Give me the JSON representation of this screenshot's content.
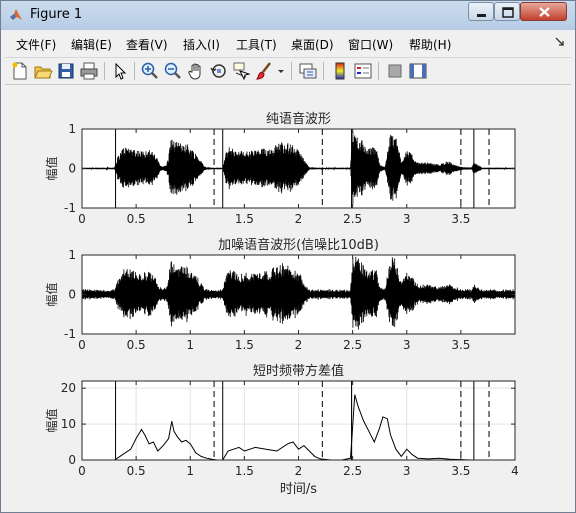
{
  "window": {
    "title": "Figure 1",
    "minimize_icon": "minimize-icon",
    "maximize_icon": "maximize-icon",
    "close_icon": "close-icon",
    "app_icon": "matlab-logo-icon"
  },
  "menubar": {
    "items": [
      "文件(F)",
      "编辑(E)",
      "查看(V)",
      "插入(I)",
      "工具(T)",
      "桌面(D)",
      "窗口(W)",
      "帮助(H)"
    ],
    "dock_icon": "dock-arrow-icon"
  },
  "toolbar": {
    "buttons": [
      "new-figure-icon",
      "open-file-icon",
      "save-icon",
      "print-icon",
      "select-pointer-icon",
      "zoom-in-icon",
      "zoom-out-icon",
      "pan-hand-icon",
      "rotate-3d-icon",
      "data-cursor-icon",
      "brush-icon",
      "brush-dropdown-icon",
      "link-plot-icon",
      "colorbar-icon",
      "legend-icon",
      "hide-plot-tools-icon",
      "show-plot-tools-icon"
    ]
  },
  "chart_data": [
    {
      "type": "line",
      "title": "纯语音波形",
      "xlabel": "",
      "ylabel": "幅值",
      "xlim": [
        0,
        4
      ],
      "ylim": [
        -1,
        1
      ],
      "xticks": [
        0,
        0.5,
        1,
        1.5,
        2,
        2.5,
        3,
        3.5
      ],
      "yticks": [
        -1,
        0,
        1
      ],
      "series": [
        {
          "style": "waveform",
          "color": "#000000",
          "envelope": {
            "t": [
              0.0,
              0.3,
              0.33,
              0.38,
              0.45,
              0.55,
              0.62,
              0.68,
              0.72,
              0.75,
              0.78,
              0.8,
              0.82,
              0.85,
              0.9,
              0.95,
              1.0,
              1.05,
              1.1,
              1.13,
              1.2,
              1.3,
              1.33,
              1.36,
              1.45,
              1.55,
              1.65,
              1.75,
              1.85,
              1.95,
              2.02,
              2.07,
              2.1,
              2.2,
              2.35,
              2.48,
              2.5,
              2.55,
              2.65,
              2.72,
              2.75,
              2.8,
              2.85,
              2.9,
              2.95,
              3.0,
              3.05,
              3.1,
              3.2,
              3.3,
              3.38,
              3.45,
              3.5,
              3.6,
              3.62,
              3.7,
              3.8,
              4.0
            ],
            "a": [
              0.02,
              0.02,
              0.3,
              0.55,
              0.55,
              0.45,
              0.5,
              0.35,
              0.1,
              0.05,
              0.1,
              0.3,
              0.8,
              0.7,
              0.65,
              0.7,
              0.55,
              0.4,
              0.2,
              0.05,
              0.02,
              0.02,
              0.4,
              0.55,
              0.45,
              0.45,
              0.5,
              0.55,
              0.7,
              0.6,
              0.4,
              0.15,
              0.03,
              0.02,
              0.02,
              0.02,
              0.95,
              0.85,
              0.5,
              0.6,
              0.1,
              0.05,
              0.9,
              0.85,
              0.2,
              0.5,
              0.35,
              0.15,
              0.15,
              0.1,
              0.2,
              0.08,
              0.04,
              0.03,
              0.15,
              0.02,
              0.02,
              0.02
            ]
          }
        }
      ],
      "vlines_solid": [
        0.31,
        1.3,
        2.49,
        3.62
      ],
      "vlines_dashed": [
        1.22,
        2.22,
        3.5,
        3.76
      ]
    },
    {
      "type": "line",
      "title": "加噪语音波形(信噪比10dB)",
      "xlabel": "",
      "ylabel": "幅值",
      "xlim": [
        0,
        4
      ],
      "ylim": [
        -1,
        1
      ],
      "xticks": [
        0,
        0.5,
        1,
        1.5,
        2,
        2.5,
        3,
        3.5
      ],
      "yticks": [
        -1,
        0,
        1
      ],
      "series": [
        {
          "style": "waveform",
          "color": "#000000",
          "noise_level": 0.12
        }
      ]
    },
    {
      "type": "line",
      "title": "短时频带方差值",
      "xlabel": "时间/s",
      "ylabel": "幅值",
      "xlim": [
        0,
        4
      ],
      "ylim": [
        0,
        22
      ],
      "xticks": [
        0,
        0.5,
        1,
        1.5,
        2,
        2.5,
        3,
        3.5,
        4
      ],
      "yticks": [
        0,
        10,
        20
      ],
      "series": [
        {
          "color": "#000000",
          "x": [
            0.0,
            0.3,
            0.35,
            0.4,
            0.45,
            0.5,
            0.55,
            0.58,
            0.62,
            0.66,
            0.7,
            0.75,
            0.8,
            0.83,
            0.85,
            0.88,
            0.92,
            0.96,
            1.0,
            1.05,
            1.1,
            1.15,
            1.2,
            1.25,
            1.3,
            1.35,
            1.4,
            1.45,
            1.5,
            1.6,
            1.7,
            1.8,
            1.9,
            1.95,
            2.0,
            2.05,
            2.1,
            2.15,
            2.2,
            2.3,
            2.4,
            2.48,
            2.52,
            2.55,
            2.6,
            2.65,
            2.7,
            2.75,
            2.78,
            2.82,
            2.85,
            2.9,
            2.95,
            3.0,
            3.05,
            3.1,
            3.2,
            3.3,
            3.4,
            3.5,
            3.6,
            3.7,
            3.8,
            4.0
          ],
          "y": [
            0.0,
            0.0,
            1.0,
            2.0,
            3.0,
            6.0,
            8.5,
            7.0,
            4.5,
            5.0,
            2.5,
            4.0,
            6.0,
            10.8,
            8.0,
            6.5,
            5.0,
            5.5,
            4.5,
            2.0,
            1.0,
            0.5,
            0.2,
            0.0,
            0.0,
            2.5,
            3.0,
            3.5,
            2.5,
            3.5,
            3.0,
            2.5,
            4.5,
            5.0,
            3.0,
            4.0,
            2.5,
            1.0,
            0.3,
            0.0,
            0.0,
            0.5,
            18.2,
            15.0,
            11.0,
            8.0,
            5.0,
            9.0,
            12.0,
            11.5,
            7.0,
            3.0,
            1.0,
            3.0,
            1.5,
            0.5,
            0.3,
            0.5,
            0.2,
            0.1,
            0.0,
            0.0,
            0.0,
            0.0
          ]
        }
      ],
      "vlines_solid": [
        0.31,
        1.3,
        2.49,
        3.62
      ],
      "vlines_dashed": [
        1.22,
        2.22,
        3.5,
        3.76
      ]
    }
  ]
}
